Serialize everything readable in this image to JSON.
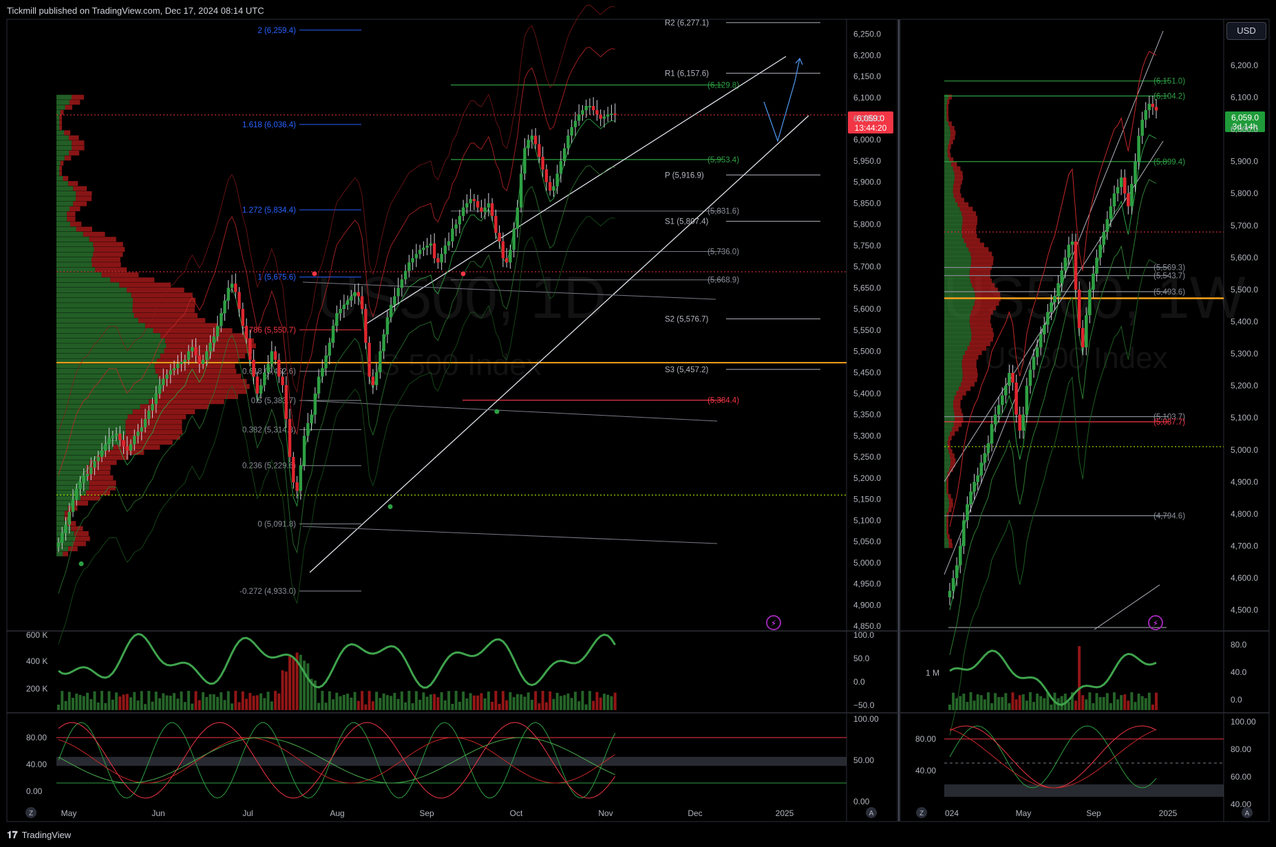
{
  "header": {
    "published": "Tickmill published on TradingView.com, Dec 17, 2024 08:14 UTC"
  },
  "footer": {
    "brand": "TradingView",
    "logo": "tv-logo-icon"
  },
  "colors": {
    "bg": "#000000",
    "up": "#2ea043",
    "down": "#e0262f",
    "grid": "#1e222d",
    "axis": "#2a2e39",
    "fib": "#2962ff",
    "pivot": "#b2b5be",
    "poc": "#f7a21b",
    "price_tag": "#f23645",
    "price_tag_w": "#26a69a"
  },
  "left_panel": {
    "symbol": "US500, 1D",
    "name": "US 500 Index",
    "price_label": "6,059.0",
    "countdown": "13:44:20",
    "y_ticks": [
      "6,250.0",
      "6,200.0",
      "6,150.0",
      "6,100.0",
      "6,050.0",
      "6,000.0",
      "5,950.0",
      "5,900.0",
      "5,850.0",
      "5,800.0",
      "5,750.0",
      "5,700.0",
      "5,650.0",
      "5,600.0",
      "5,550.0",
      "5,500.0",
      "5,450.0",
      "5,400.0",
      "5,350.0",
      "5,300.0",
      "5,250.0",
      "5,200.0",
      "5,150.0",
      "5,100.0",
      "5,050.0",
      "5,000.0",
      "4,950.0",
      "4,900.0",
      "4,850.0"
    ],
    "x_ticks": [
      "May",
      "Jun",
      "Jul",
      "Aug",
      "Sep",
      "Oct",
      "Nov",
      "Dec",
      "2025"
    ],
    "fib_labels": [
      "2 (6,259.4)",
      "1.618 (6,036.4)",
      "1.272 (5,834.4)",
      "1 (5,675.6)",
      "0.786 (5,550.7)",
      "0.618 (5,452.6)",
      "0.5 (5,383.7)",
      "0.382 (5,314.8)",
      "0.236 (5,229.6)",
      "0 (5,091.8)",
      "-0.272 (4,933.0)"
    ],
    "pivot_labels": [
      "R2 (6,277.1)",
      "R1 (6,157.6)",
      "P (5,916.9)",
      "S1 (5,807.4)",
      "S2 (5,576.7)",
      "S3 (5,457.2)"
    ],
    "level_labels": [
      "(6,129.8)",
      "(5,953.4)",
      "(5,831.6)",
      "(5,736.0)",
      "(5,668.9)",
      "(5,384.4)"
    ],
    "volume_ticks": [
      "600 K",
      "400 K",
      "200 K"
    ],
    "osc1_ticks": [
      "100.0",
      "50.0",
      "0.0",
      "−50.0"
    ],
    "osc2_left_ticks": [
      "80.00",
      "40.00",
      "0.00"
    ],
    "osc2_right_ticks": [
      "100.00",
      "50.00",
      "0.00"
    ]
  },
  "right_panel": {
    "symbol": "US500, 1W",
    "name": "US 500 Index",
    "currency": "USD",
    "price_label": "6,059.0",
    "countdown": "3d 14h",
    "y_ticks": [
      "6,200.0",
      "6,100.0",
      "6,000.0",
      "5,900.0",
      "5,800.0",
      "5,700.0",
      "5,600.0",
      "5,500.0",
      "5,400.0",
      "5,300.0",
      "5,200.0",
      "5,100.0",
      "5,000.0",
      "4,900.0",
      "4,800.0",
      "4,700.0",
      "4,600.0",
      "4,500.0"
    ],
    "x_ticks": [
      "024",
      "May",
      "Sep",
      "2025"
    ],
    "level_labels": [
      "(6,151.0)",
      "(6,104.2)",
      "(5,899.4)",
      "(5,569.3)",
      "(5,543.7)",
      "(5,493.6)",
      "(5,103.7)",
      "(5,087.7)",
      "(4,794.6)"
    ],
    "osc1_ticks": [
      "80.0",
      "40.0",
      "0.0"
    ],
    "volume_tick": "1 M",
    "osc2_left_ticks": [
      "80.00",
      "40.00"
    ],
    "osc2_right_ticks": [
      "100.00",
      "80.00",
      "60.00",
      "40.00"
    ]
  },
  "chart_data": [
    {
      "type": "candlestick",
      "title": "US500, 1D",
      "ylim": [
        4850,
        6290
      ],
      "x_range": [
        "2024-04-27",
        "2025-01-04"
      ],
      "x_months": [
        "May",
        "Jun",
        "Jul",
        "Aug",
        "Sep",
        "Oct",
        "Nov",
        "Dec",
        "2025"
      ],
      "close": [
        5047,
        5070,
        5090,
        5120,
        5150,
        5175,
        5190,
        5205,
        5210,
        5225,
        5240,
        5250,
        5265,
        5280,
        5295,
        5300,
        5305,
        5290,
        5275,
        5265,
        5280,
        5300,
        5310,
        5320,
        5340,
        5360,
        5375,
        5400,
        5420,
        5435,
        5445,
        5455,
        5460,
        5470,
        5475,
        5480,
        5500,
        5510,
        5490,
        5470,
        5480,
        5500,
        5520,
        5535,
        5560,
        5590,
        5620,
        5650,
        5660,
        5640,
        5600,
        5560,
        5530,
        5480,
        5440,
        5400,
        5420,
        5450,
        5470,
        5500,
        5480,
        5440,
        5420,
        5340,
        5250,
        5190,
        5170,
        5230,
        5300,
        5330,
        5350,
        5400,
        5440,
        5460,
        5490,
        5520,
        5560,
        5590,
        5600,
        5610,
        5620,
        5630,
        5640,
        5630,
        5600,
        5520,
        5440,
        5420,
        5450,
        5500,
        5540,
        5580,
        5610,
        5630,
        5650,
        5670,
        5690,
        5710,
        5720,
        5730,
        5740,
        5745,
        5750,
        5755,
        5720,
        5710,
        5730,
        5750,
        5760,
        5790,
        5800,
        5820,
        5840,
        5850,
        5860,
        5855,
        5840,
        5830,
        5840,
        5850,
        5820,
        5780,
        5760,
        5720,
        5710,
        5740,
        5790,
        5840,
        5920,
        5980,
        6000,
        6010,
        5990,
        5960,
        5930,
        5900,
        5880,
        5890,
        5920,
        5950,
        5980,
        6010,
        6030,
        6045,
        6060,
        6070,
        6080,
        6080,
        6070,
        6060,
        6050,
        6055,
        6060,
        6062,
        6059
      ],
      "fib_levels": [
        6259.4,
        6036.4,
        5834.4,
        5675.6,
        5550.7,
        5452.6,
        5383.7,
        5314.8,
        5229.6,
        5091.8,
        4933.0
      ],
      "pivots": {
        "R2": 6277.1,
        "R1": 6157.6,
        "P": 5916.9,
        "S1": 5807.4,
        "S2": 5576.7,
        "S3": 5457.2
      },
      "levels": [
        6129.8,
        5953.4,
        5831.6,
        5736.0,
        5668.9,
        5384.4
      ],
      "poc": 5473,
      "last": 6059.0
    },
    {
      "type": "candlestick",
      "title": "US500, 1W",
      "ylim": [
        4450,
        6350
      ],
      "x_range": [
        "2023-11-20",
        "2025-02-10"
      ],
      "x_months": [
        "024",
        "May",
        "Sep",
        "2025"
      ],
      "close": [
        4560,
        4600,
        4640,
        4700,
        4780,
        4830,
        4870,
        4900,
        4920,
        4960,
        4990,
        5020,
        5080,
        5110,
        5140,
        5170,
        5200,
        5240,
        5210,
        5110,
        5060,
        5110,
        5200,
        5250,
        5290,
        5320,
        5360,
        5390,
        5430,
        5460,
        5480,
        5520,
        5560,
        5600,
        5640,
        5650,
        5500,
        5380,
        5320,
        5420,
        5500,
        5550,
        5600,
        5640,
        5680,
        5720,
        5760,
        5800,
        5820,
        5850,
        5800,
        5760,
        5830,
        5900,
        5980,
        6030,
        6060,
        6080,
        6070,
        6059
      ],
      "levels": [
        6151.0,
        6104.2,
        5899.4,
        5569.3,
        5543.7,
        5493.6,
        5103.7,
        5087.7,
        4794.6
      ],
      "poc": 5473,
      "last": 6059.0
    }
  ]
}
